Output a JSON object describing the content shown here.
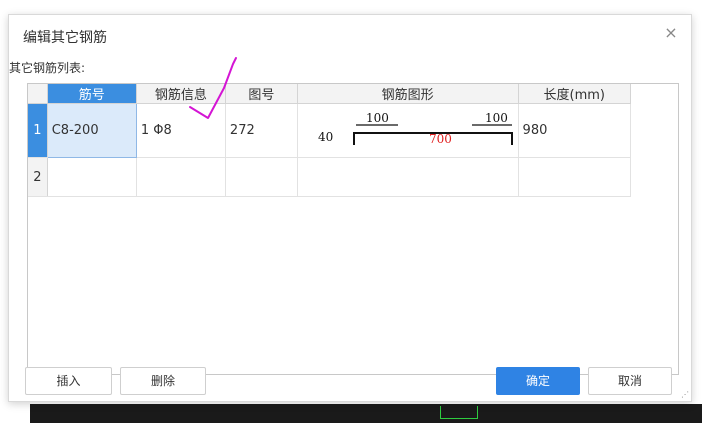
{
  "dialog": {
    "title": "编辑其它钢筋",
    "close_symbol": "×",
    "list_label": "其它钢筋列表:"
  },
  "table": {
    "headers": [
      "",
      "筋号",
      "钢筋信息",
      "图号",
      "钢筋图形",
      "长度(mm)"
    ],
    "rows": [
      {
        "num": "1",
        "bar_no": "C8-200",
        "bar_info": "1 Φ8",
        "fig_no": "272",
        "shape": {
          "left_dim": "40",
          "top_left_dim": "100",
          "top_right_dim": "100",
          "mid_dim": "700"
        },
        "length": "980"
      },
      {
        "num": "2",
        "bar_no": "",
        "bar_info": "",
        "fig_no": "",
        "shape": null,
        "length": ""
      }
    ]
  },
  "buttons": {
    "insert": "插入",
    "delete": "删除",
    "ok": "确定",
    "cancel": "取消"
  },
  "colors": {
    "accent": "#2f83e4",
    "annotation_stroke": "#d415d4",
    "dimension_red": "#e02020"
  }
}
